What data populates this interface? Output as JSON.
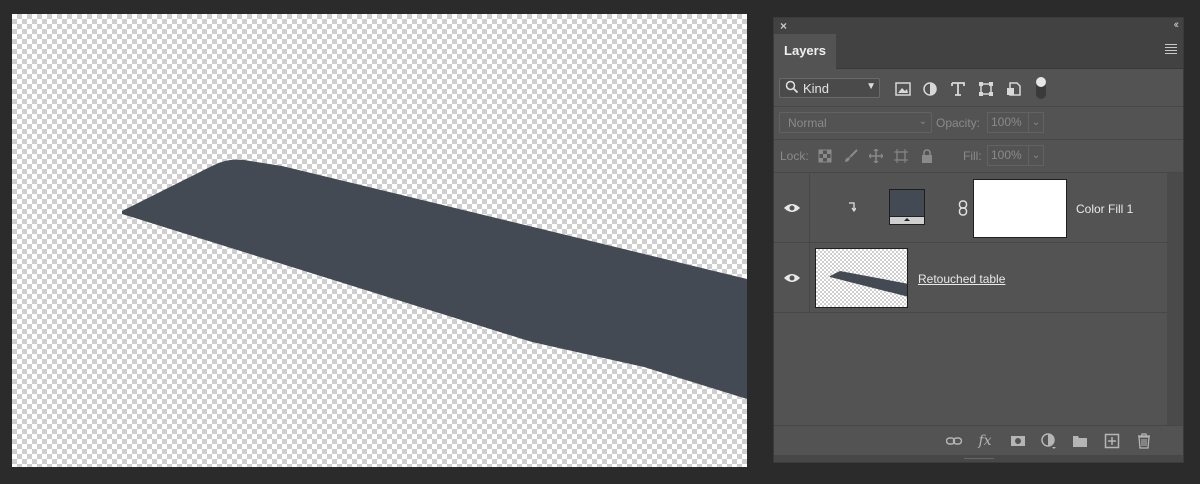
{
  "panel": {
    "tab_label": "Layers",
    "close_glyph": "×",
    "collapse_glyph": "‹‹"
  },
  "filter": {
    "kind_label": "Kind",
    "icons": [
      "image-filter-icon",
      "adjustment-filter-icon",
      "type-filter-icon",
      "shape-filter-icon",
      "smart-object-filter-icon"
    ]
  },
  "blend": {
    "mode": "Normal",
    "opacity_label": "Opacity:",
    "opacity_value": "100%"
  },
  "lock": {
    "label": "Lock:",
    "fill_label": "Fill:",
    "fill_value": "100%"
  },
  "layers": [
    {
      "name": "Color Fill 1",
      "visible": true,
      "clipped": true,
      "fill_color": "#434a53"
    },
    {
      "name": "Retouched table",
      "visible": true
    }
  ],
  "colors": {
    "table_shape": "#434a53",
    "panel_bg": "#535353"
  }
}
